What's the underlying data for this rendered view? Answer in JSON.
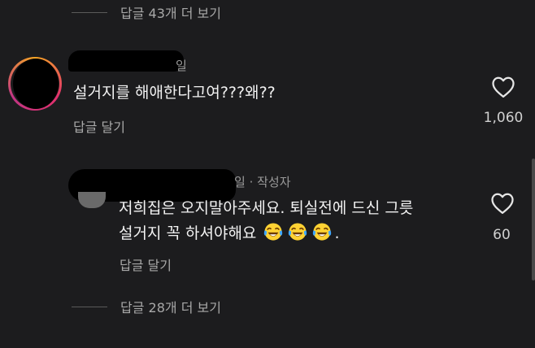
{
  "thread": {
    "more_replies_top": "답글 43개 더 보기",
    "more_replies_bottom": "답글 28개 더 보기"
  },
  "comment": {
    "time_suffix": "일",
    "text": "설거지를 해애한다고여???왜??",
    "reply_label": "답글 달기",
    "like_count": "1,060",
    "like_icon": "heart-outline-icon"
  },
  "reply": {
    "meta_suffix": "일 · 작성자",
    "text_line1": "저희집은 오지말아주세요. 퇴실전에 드신 그릇",
    "text_line2": "설거지 꼭 하셔야해요",
    "text_end": ".",
    "emoji": "tears-of-joy-emoji",
    "reply_label": "답글 달기",
    "like_count": "60",
    "like_icon": "heart-outline-icon"
  },
  "colors": {
    "background": "#1c1c1e",
    "text": "#f2f2f2",
    "muted": "#a8a8a8",
    "avatar_ring": "#e1306c"
  }
}
